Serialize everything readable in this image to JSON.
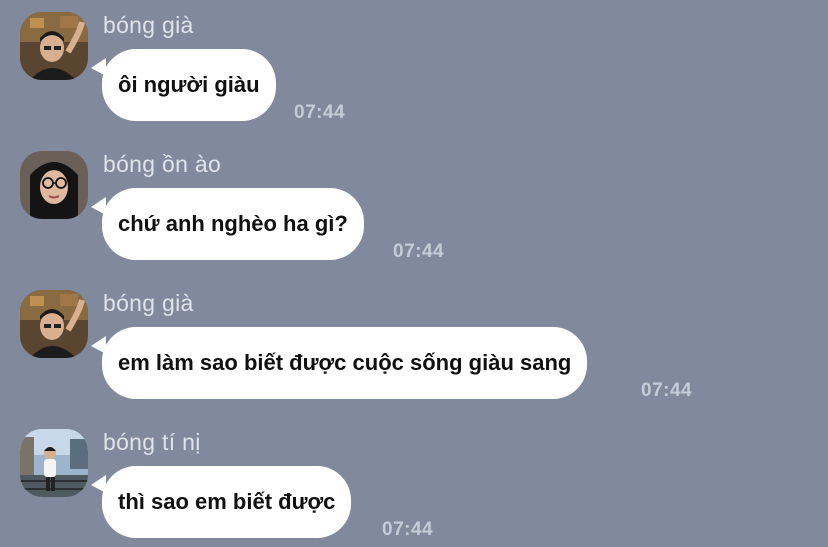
{
  "colors": {
    "background": "#808a9c",
    "bubble": "#ffffff",
    "sender_name": "#dfe3ea",
    "timestamp": "#c5ccd7"
  },
  "messages": [
    {
      "sender": "bóng già",
      "text": "ôi người giàu",
      "time": "07:44",
      "avatar": "avatar-photo-icon"
    },
    {
      "sender": "bóng ồn ào",
      "text": "chứ anh nghèo ha gì?",
      "time": "07:44",
      "avatar": "avatar-photo-icon"
    },
    {
      "sender": "bóng già",
      "text": "em làm sao biết được cuộc sống giàu sang",
      "time": "07:44",
      "avatar": "avatar-photo-icon"
    },
    {
      "sender": "bóng tí nị",
      "text": "thì sao em biết được",
      "time": "07:44",
      "avatar": "avatar-photo-icon"
    }
  ]
}
